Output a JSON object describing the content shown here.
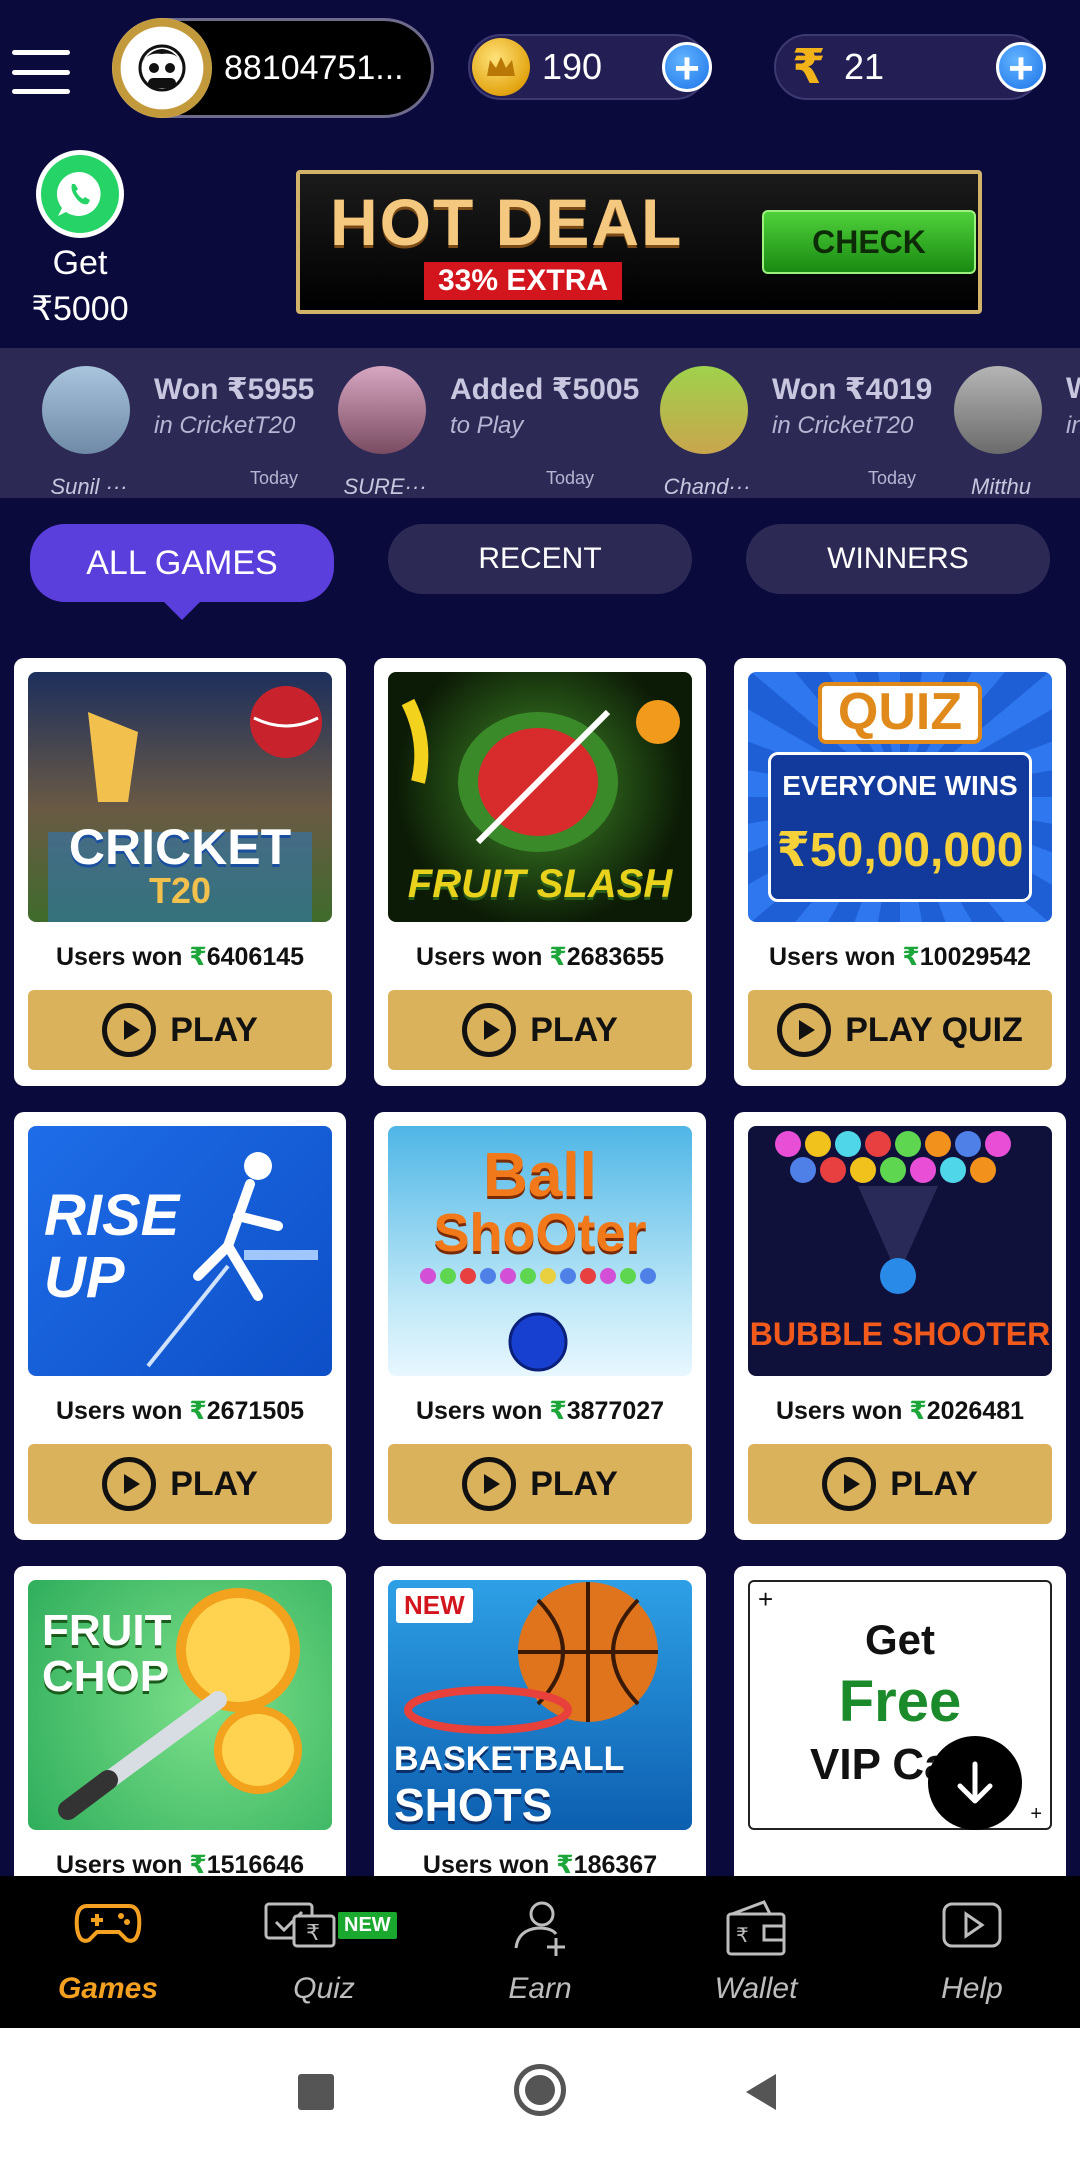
{
  "header": {
    "profile_id": "88104751...",
    "coins": "190",
    "balance": "21",
    "rupee_symbol": "₹",
    "plus": "+"
  },
  "promo": {
    "whatsapp_line1": "Get",
    "whatsapp_line2": "₹5000",
    "hot_deal_title": "HOT DEAL",
    "hot_deal_extra": "33% EXTRA",
    "hot_deal_button": "CHECK"
  },
  "ticker": [
    {
      "amount": "Won ₹5955",
      "sub": "in CricketT20",
      "time": "Today",
      "name": "Sunil ···"
    },
    {
      "amount": "Added ₹5005",
      "sub": "to Play",
      "time": "Today",
      "name": "SURE···"
    },
    {
      "amount": "Won ₹4019",
      "sub": "in CricketT20",
      "time": "Today",
      "name": "Chand···"
    },
    {
      "amount": "W",
      "sub": "in",
      "time": "",
      "name": "Mitthu"
    }
  ],
  "tabs": {
    "all_games": "ALL GAMES",
    "recent": "RECENT",
    "winners": "WINNERS"
  },
  "games": [
    {
      "title_line1": "CRICKET",
      "title_line2": "T20",
      "won_prefix": "Users won ",
      "rs": "₹",
      "won_value": "6406145",
      "button": "PLAY"
    },
    {
      "title_line1": "FRUIT SLASH",
      "won_prefix": "Users won ",
      "rs": "₹",
      "won_value": "2683655",
      "button": "PLAY"
    },
    {
      "title_line1": "QUIZ",
      "title_line2": "EVERYONE WINS",
      "title_line3": "₹50,00,000",
      "won_prefix": "Users won ",
      "rs": "₹",
      "won_value": "10029542",
      "button": "PLAY QUIZ"
    },
    {
      "title_line1": "RISE",
      "title_line2": "UP",
      "won_prefix": "Users won ",
      "rs": "₹",
      "won_value": "2671505",
      "button": "PLAY"
    },
    {
      "title_line1": "Ball",
      "title_line2": "ShoOter",
      "won_prefix": "Users won ",
      "rs": "₹",
      "won_value": "3877027",
      "button": "PLAY"
    },
    {
      "title_line1": "BUBBLE SHOOTER",
      "won_prefix": "Users won ",
      "rs": "₹",
      "won_value": "2026481",
      "button": "PLAY"
    },
    {
      "title_line1": "FRUIT",
      "title_line2": "CHOP",
      "won_prefix": "Users won ",
      "rs": "₹",
      "won_value": "1516646"
    },
    {
      "badge": "NEW",
      "title_line1": "BASKETBALL",
      "title_line2": "SHOTS",
      "won_prefix": "Users won ",
      "rs": "₹",
      "won_value": "186367"
    }
  ],
  "vip_card": {
    "line1": "Get",
    "line2": "Free",
    "line3": "VIP Ca",
    "corner": "+"
  },
  "bottom_nav": {
    "games": "Games",
    "quiz": "Quiz",
    "quiz_badge": "NEW",
    "earn": "Earn",
    "wallet": "Wallet",
    "help": "Help"
  },
  "colors": {
    "background": "#0b0a3d",
    "active_tab": "#5b3fdd",
    "play_button": "#dbb25c",
    "won_green": "#1ca63a",
    "nav_active": "#f4a020"
  }
}
